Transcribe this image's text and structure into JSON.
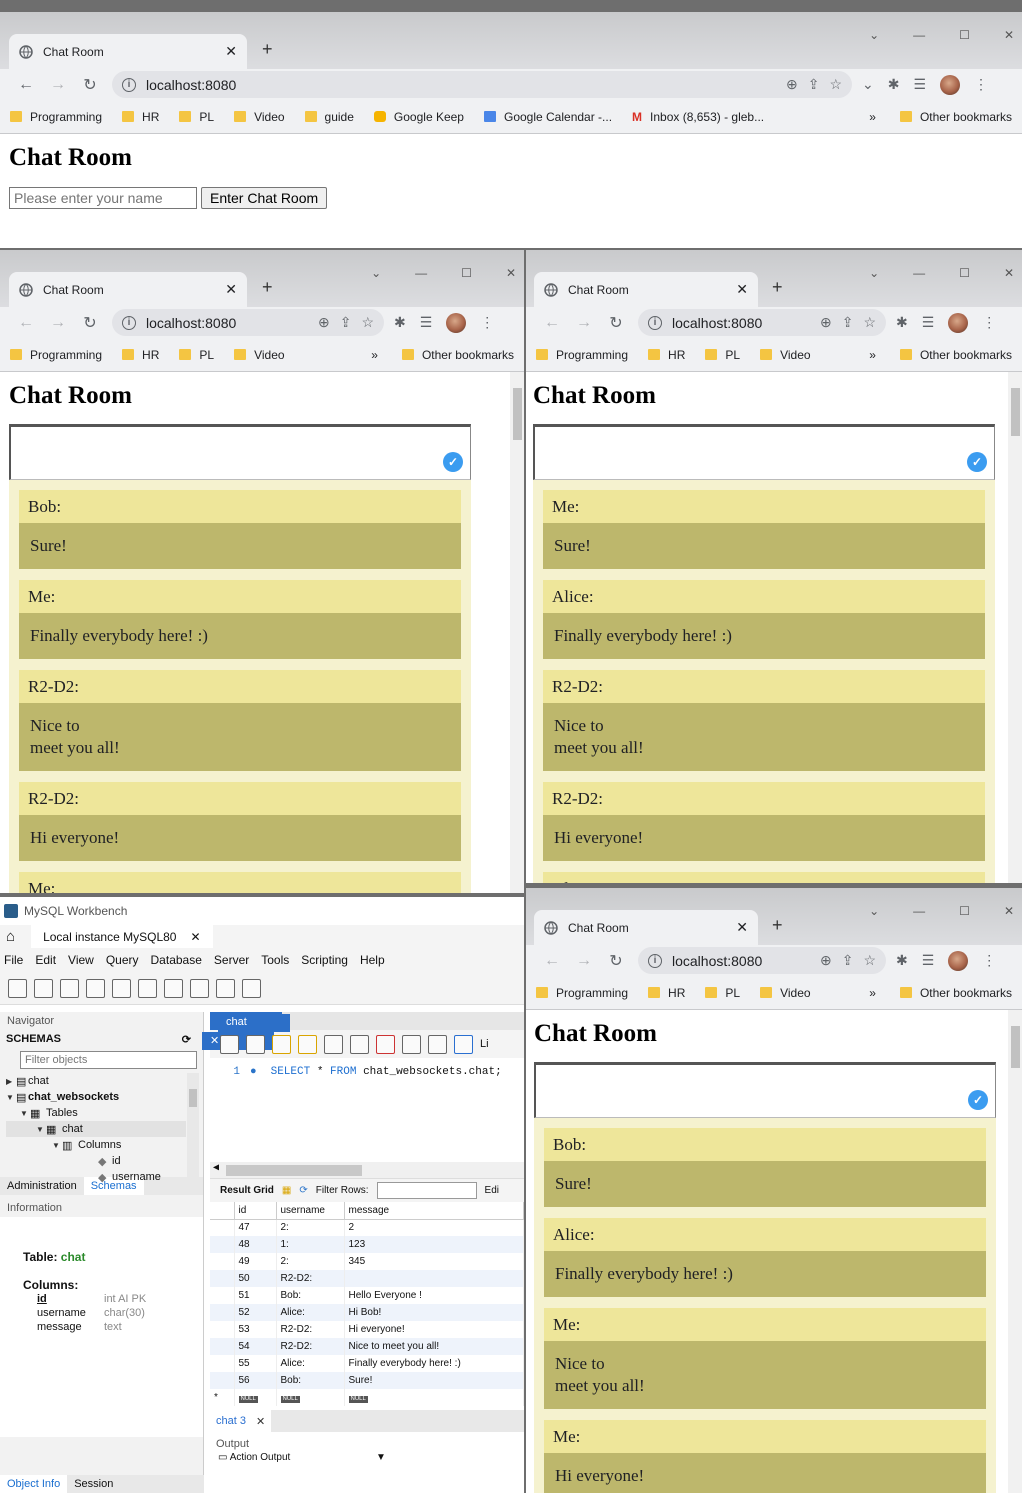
{
  "browser": {
    "tab_title": "Chat Room",
    "url": "localhost:8080",
    "bookmarks_full": [
      "Programming",
      "HR",
      "PL",
      "Video",
      "guide",
      "Google Keep",
      "Google Calendar -...",
      "Inbox (8,653) - gleb..."
    ],
    "bookmarks_short": [
      "Programming",
      "HR",
      "PL",
      "Video"
    ],
    "other_bookmarks": "Other bookmarks",
    "overflow": "»"
  },
  "login": {
    "title": "Chat Room",
    "name_placeholder": "Please enter your name",
    "enter_button": "Enter Chat Room"
  },
  "chat_windows": [
    {
      "title": "Chat Room",
      "messages": [
        {
          "who": "Bob:",
          "text": "Sure!"
        },
        {
          "who": "Me:",
          "text": "Finally everybody here! :)"
        },
        {
          "who": "R2-D2:",
          "text": "Nice to",
          "text2": "meet you all!"
        },
        {
          "who": "R2-D2:",
          "text": "Hi everyone!"
        },
        {
          "who": "Me:",
          "text": ""
        }
      ]
    },
    {
      "title": "Chat Room",
      "messages": [
        {
          "who": "Me:",
          "text": "Sure!"
        },
        {
          "who": "Alice:",
          "text": "Finally everybody here! :)"
        },
        {
          "who": "R2-D2:",
          "text": "Nice to",
          "text2": "meet you all!"
        },
        {
          "who": "R2-D2:",
          "text": "Hi everyone!"
        },
        {
          "who": "Alice:",
          "text": ""
        }
      ]
    },
    {
      "title": "Chat Room",
      "messages": [
        {
          "who": "Bob:",
          "text": "Sure!"
        },
        {
          "who": "Alice:",
          "text": "Finally everybody here! :)"
        },
        {
          "who": "Me:",
          "text": "Nice to",
          "text2": "meet you all!"
        },
        {
          "who": "Me:",
          "text": "Hi everyone!"
        }
      ]
    }
  ],
  "workbench": {
    "app_title": "MySQL Workbench",
    "connection_tab": "Local instance MySQL80",
    "menu": [
      "File",
      "Edit",
      "View",
      "Query",
      "Database",
      "Server",
      "Tools",
      "Scripting",
      "Help"
    ],
    "navigator_label": "Navigator",
    "schemas_label": "SCHEMAS",
    "filter_placeholder": "Filter objects",
    "tree": [
      "chat",
      "chat_websockets",
      "Tables",
      "chat",
      "Columns",
      "id",
      "username"
    ],
    "admin_tab": "Administration",
    "schemas_tab": "Schemas",
    "information_label": "Information",
    "info_table_label": "Table:",
    "info_table_name": "chat",
    "info_columns_label": "Columns:",
    "info_columns": [
      {
        "name": "id",
        "type": "int AI PK"
      },
      {
        "name": "username",
        "type": "char(30)"
      },
      {
        "name": "message",
        "type": "text"
      }
    ],
    "object_info_tab": "Object Info",
    "session_tab": "Session",
    "editor_tab": "chat",
    "limit_fragment": "Li",
    "sql_line_no": "1",
    "sql_select": "SELECT",
    "sql_star": "*",
    "sql_from": "FROM",
    "sql_rest": "chat_websockets.chat;",
    "result_grid_label": "Result Grid",
    "filter_rows_label": "Filter Rows:",
    "edit_label": "Edi",
    "columns": [
      "id",
      "username",
      "message"
    ],
    "rows": [
      [
        "47",
        "2:",
        "2"
      ],
      [
        "48",
        "1:",
        "123"
      ],
      [
        "49",
        "2:",
        "345"
      ],
      [
        "50",
        "R2-D2:",
        ""
      ],
      [
        "51",
        "Bob:",
        "Hello Everyone !"
      ],
      [
        "52",
        "Alice:",
        "Hi Bob!"
      ],
      [
        "53",
        "R2-D2:",
        "Hi everyone!"
      ],
      [
        "54",
        "R2-D2:",
        "Nice to  meet you all!"
      ],
      [
        "55",
        "Alice:",
        "Finally everybody here! :)"
      ],
      [
        "56",
        "Bob:",
        "Sure!"
      ]
    ],
    "null_label": "NULL",
    "result_tab": "chat 3",
    "output_label": "Output",
    "action_output": "Action Output"
  }
}
